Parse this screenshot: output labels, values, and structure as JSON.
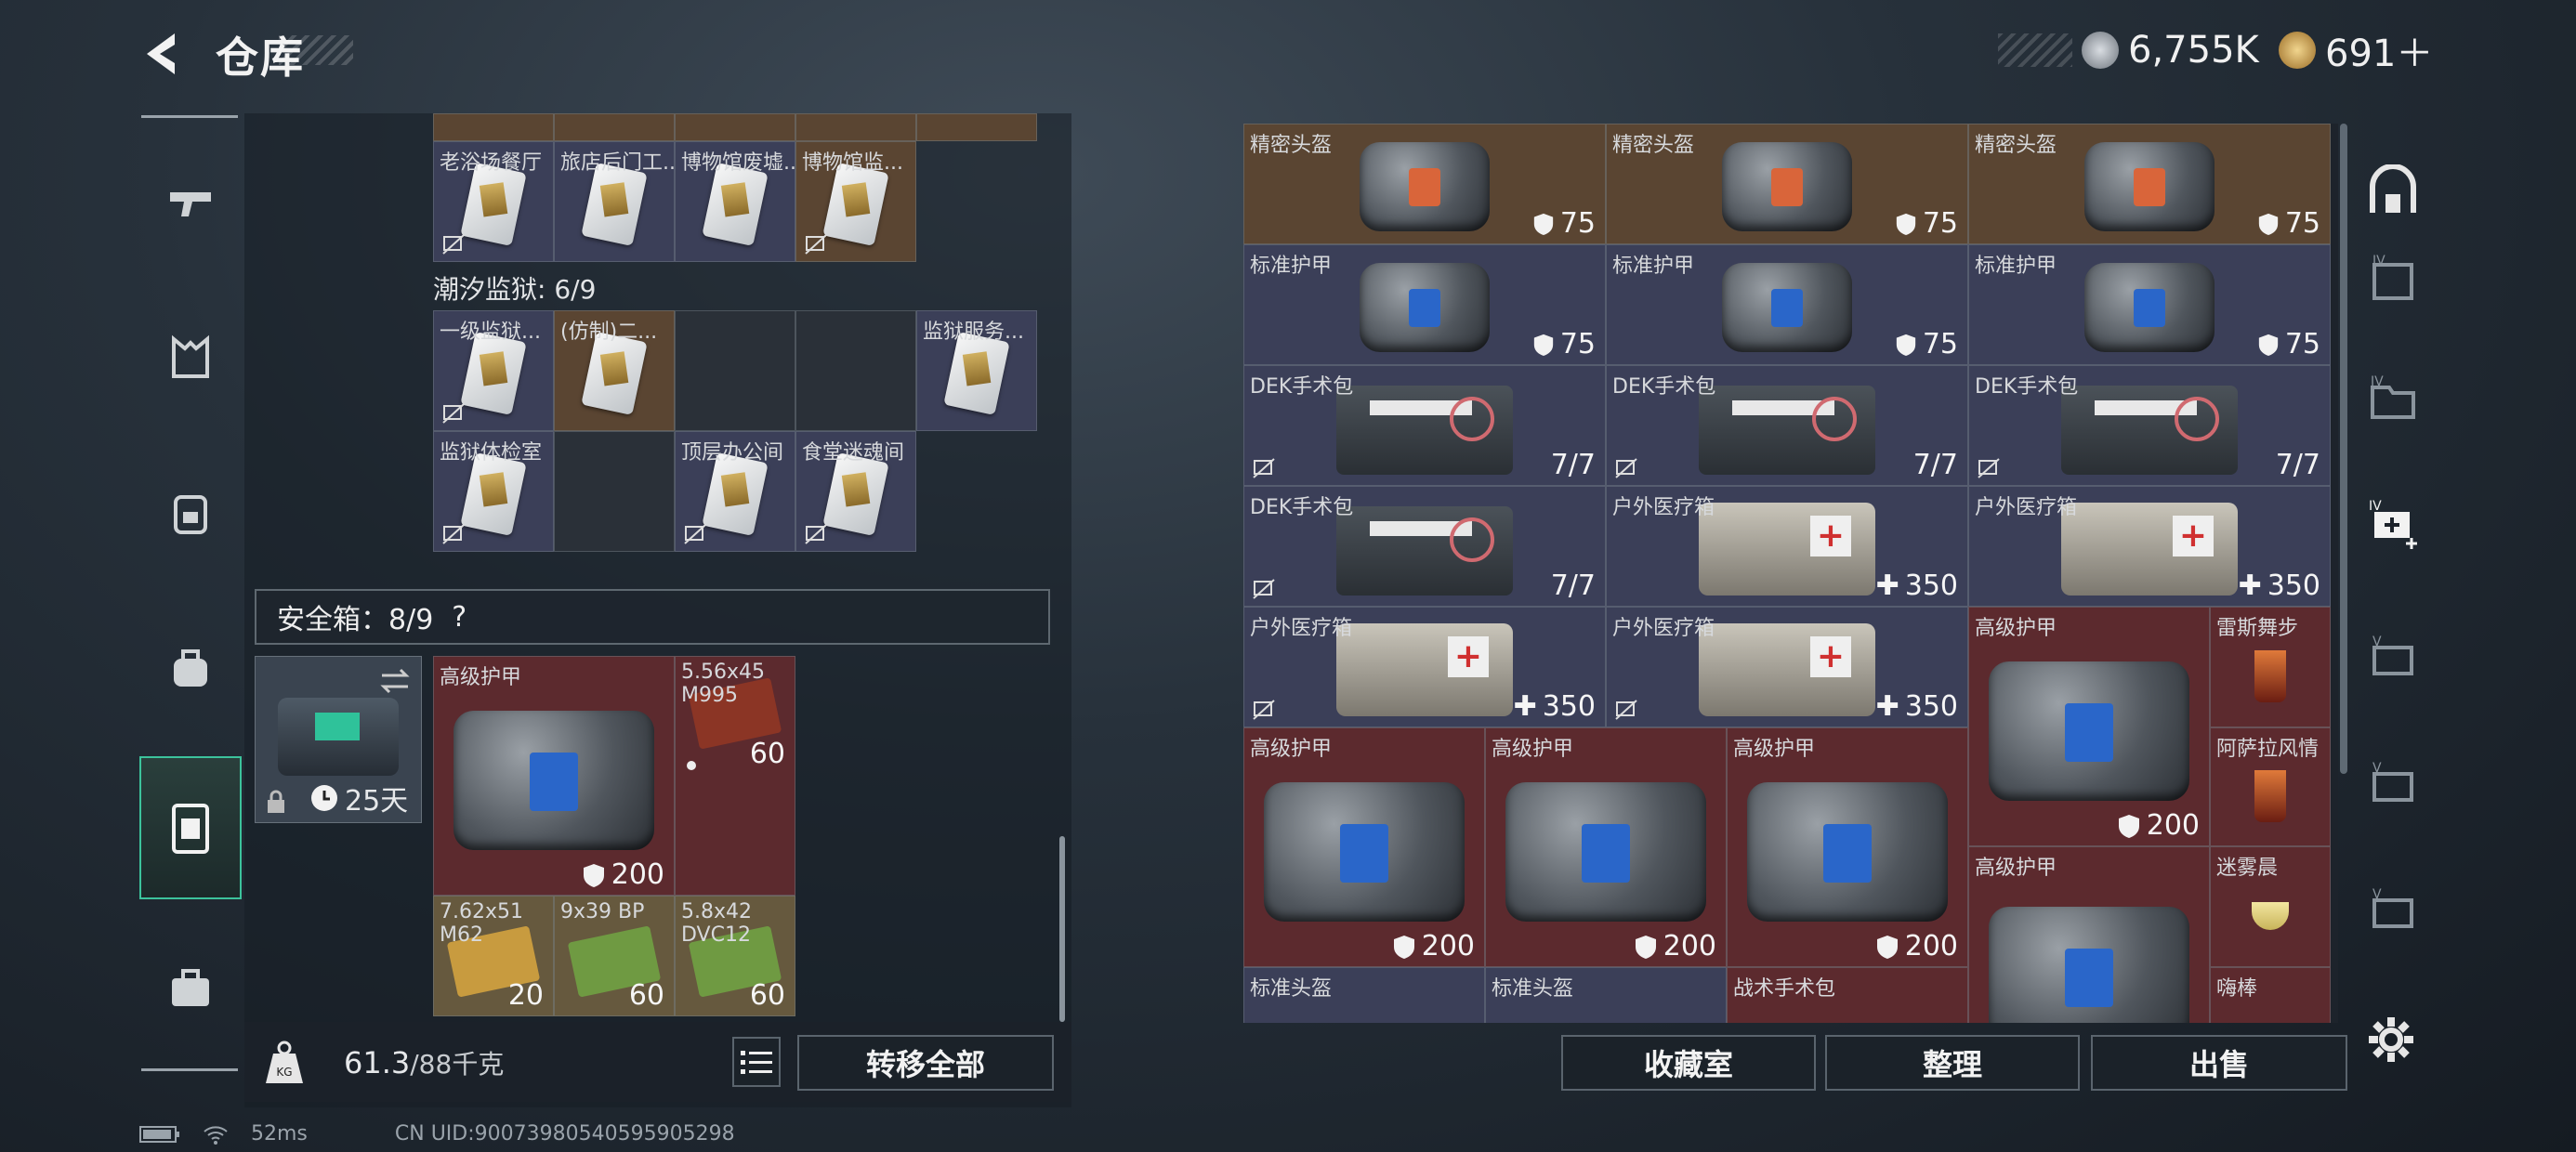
{
  "header": {
    "title": "仓库",
    "currency1": "6,755K",
    "currency2": "691＋",
    "colors": {
      "coin1": "#9aa2ab",
      "coin2": "#c9a14e"
    }
  },
  "left_nav": [
    {
      "icon": "gun-icon"
    },
    {
      "icon": "vest-icon"
    },
    {
      "icon": "backpack-icon"
    },
    {
      "icon": "bag-icon"
    },
    {
      "icon": "case-icon"
    },
    {
      "icon": "toolbox-icon"
    }
  ],
  "collection_top": {
    "items": [
      "老浴场餐厅",
      "旅店后门工...",
      "博物馆废墟...",
      "博物馆监..."
    ]
  },
  "prison": {
    "section": "潮汐监狱: 6/9",
    "items": [
      "一级监狱...",
      "(仿制)二...",
      "监狱服务...",
      "监狱体检室",
      "顶层办公间",
      "食堂迷魂间"
    ]
  },
  "safe": {
    "title": "安全箱：8/9",
    "help": "?",
    "timer": "25天",
    "items": [
      {
        "label": "高级护甲",
        "value": "200"
      },
      {
        "label": "5.56x45 M995",
        "value": "60"
      },
      {
        "label": "7.62x51 M62",
        "value": "20"
      },
      {
        "label": "9x39 BP",
        "value": "60"
      },
      {
        "label": "5.8x42 DVC12",
        "value": "60"
      }
    ]
  },
  "weight": {
    "current": "61.3",
    "max": "/88千克"
  },
  "buttons": {
    "transfer_all": "转移全部",
    "collection": "收藏室",
    "organize": "整理",
    "sell": "出售"
  },
  "stash": {
    "row1": [
      {
        "label": "精密头盔",
        "value": "75"
      },
      {
        "label": "精密头盔",
        "value": "75"
      },
      {
        "label": "精密头盔",
        "value": "75"
      }
    ],
    "row2": [
      {
        "label": "标准护甲",
        "value": "75"
      },
      {
        "label": "标准护甲",
        "value": "75"
      },
      {
        "label": "标准护甲",
        "value": "75"
      }
    ],
    "row3": [
      {
        "label": "DEK手术包",
        "value": "7/7"
      },
      {
        "label": "DEK手术包",
        "value": "7/7"
      },
      {
        "label": "DEK手术包",
        "value": "7/7"
      }
    ],
    "row4": [
      {
        "label": "DEK手术包",
        "value": "7/7"
      },
      {
        "label": "户外医疗箱",
        "value": "350"
      },
      {
        "label": "户外医疗箱",
        "value": "350"
      }
    ],
    "row5": [
      {
        "label": "户外医疗箱",
        "value": "350"
      },
      {
        "label": "户外医疗箱",
        "value": "350"
      }
    ],
    "big_armor": [
      {
        "label": "高级护甲",
        "value": "200"
      },
      {
        "label": "高级护甲",
        "value": "200"
      },
      {
        "label": "高级护甲",
        "value": "200"
      }
    ],
    "right_armor": [
      {
        "label": "高级护甲",
        "value": "200"
      },
      {
        "label": "高级护甲"
      }
    ],
    "drinks": [
      "雷斯舞步",
      "阿萨拉风情",
      "迷雾晨",
      "嗨棒"
    ],
    "bottom_row": [
      "标准头盔",
      "标准头盔",
      "战术手术包"
    ]
  },
  "status": {
    "ping": "52ms",
    "uid": "CN UID:9007398054059590529​8"
  }
}
